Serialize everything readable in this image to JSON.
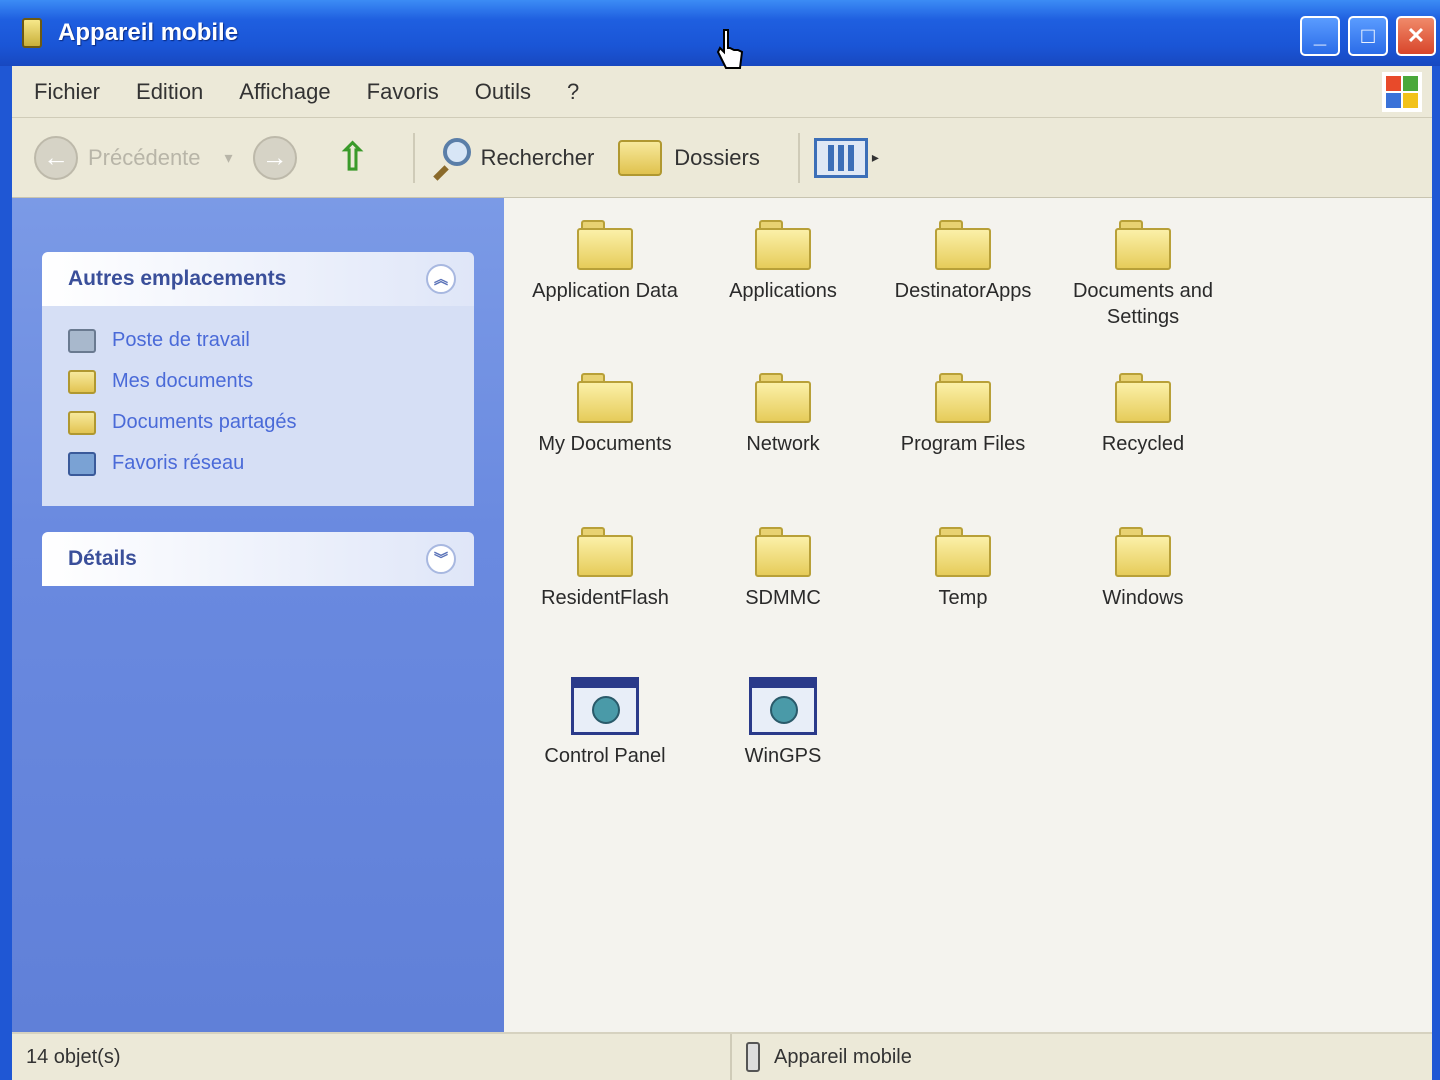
{
  "window": {
    "title": "Appareil mobile"
  },
  "menu": {
    "items": [
      "Fichier",
      "Edition",
      "Affichage",
      "Favoris",
      "Outils",
      "?"
    ]
  },
  "toolbar": {
    "back_label": "Précédente",
    "search_label": "Rechercher",
    "folders_label": "Dossiers"
  },
  "left_pane": {
    "other_places": {
      "title": "Autres emplacements",
      "items": [
        {
          "label": "Poste de travail",
          "icon": "computer-icon"
        },
        {
          "label": "Mes documents",
          "icon": "folder-icon"
        },
        {
          "label": "Documents partagés",
          "icon": "folder-icon"
        },
        {
          "label": "Favoris réseau",
          "icon": "network-icon"
        }
      ]
    },
    "details": {
      "title": "Détails"
    }
  },
  "files": [
    {
      "label": "Application Data",
      "type": "folder"
    },
    {
      "label": "Applications",
      "type": "folder"
    },
    {
      "label": "DestinatorApps",
      "type": "folder"
    },
    {
      "label": "Documents and Settings",
      "type": "folder"
    },
    {
      "label": "My Documents",
      "type": "folder"
    },
    {
      "label": "Network",
      "type": "folder"
    },
    {
      "label": "Program Files",
      "type": "folder"
    },
    {
      "label": "Recycled",
      "type": "folder"
    },
    {
      "label": "ResidentFlash",
      "type": "folder"
    },
    {
      "label": "SDMMC",
      "type": "folder"
    },
    {
      "label": "Temp",
      "type": "folder"
    },
    {
      "label": "Windows",
      "type": "folder"
    },
    {
      "label": "Control Panel",
      "type": "shortcut"
    },
    {
      "label": "WinGPS",
      "type": "app"
    }
  ],
  "statusbar": {
    "object_count": "14 objet(s)",
    "location": "Appareil mobile"
  },
  "colors": {
    "titlebar": "#1f5fe0",
    "left_pane": "#6a8ae0",
    "panel_body": "#d6dff5",
    "link": "#4a6ad8"
  }
}
